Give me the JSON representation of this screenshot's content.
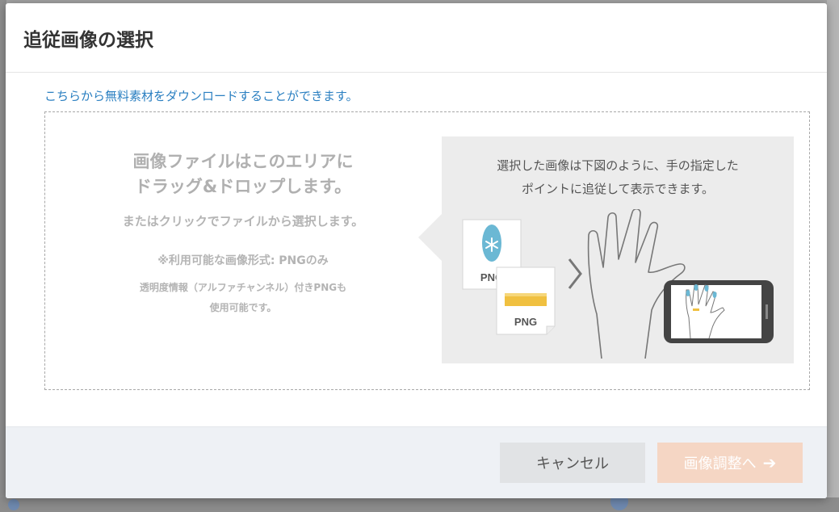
{
  "dialog": {
    "title": "追従画像の選択",
    "download_link": "こちらから無料素材をダウンロードすることができます。"
  },
  "drop_zone": {
    "main_line1": "画像ファイルはこのエリアに",
    "main_line2": "ドラッグ&ドロップします。",
    "sub": "またはクリックでファイルから選択します。",
    "note1": "※利用可能な画像形式: PNGのみ",
    "note2_line1": "透明度情報（アルファチャンネル）付きPNGも",
    "note2_line2": "使用可能です。"
  },
  "info": {
    "line1": "選択した画像は下図のように、手の指定した",
    "line2": "ポイントに追従して表示できます。",
    "file_label_1": "PNG",
    "file_label_2": "PNG"
  },
  "footer": {
    "cancel_label": "キャンセル",
    "next_label": "画像調整へ",
    "next_arrow": "➔"
  },
  "colors": {
    "link": "#2a7fc1",
    "next_button": "#f5d6c4",
    "cancel_button": "#e1e3e5",
    "nail_blue": "#6bb8d4",
    "ring_gold": "#f0c040"
  }
}
